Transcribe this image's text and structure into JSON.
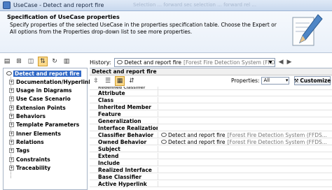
{
  "window": {
    "title": "UseCase - Detect and report fire",
    "ghost_titles": "Selection ... forward sec selection ... forward rel ..."
  },
  "header": {
    "title": "Specification of UseCase properties",
    "description": "Specify properties of the selected UseCase in the properties specification table. Choose the Expert or All options from the Properties drop-down list to see more properties.",
    "icon": "pen-icon"
  },
  "history": {
    "label": "History:",
    "element": "Detect and report fire",
    "element_path": "[Forest Fire Detection System (FFDS)::..."
  },
  "tree": {
    "items": [
      {
        "label": "Detect and report fire",
        "selected": true
      },
      {
        "label": "Documentation/Hyperlinks"
      },
      {
        "label": "Usage in Diagrams"
      },
      {
        "label": "Use Case Scenario"
      },
      {
        "label": "Extension Points"
      },
      {
        "label": "Behaviors"
      },
      {
        "label": "Template Parameters"
      },
      {
        "label": "Inner Elements"
      },
      {
        "label": "Relations"
      },
      {
        "label": "Tags"
      },
      {
        "label": "Constraints"
      },
      {
        "label": "Traceability"
      }
    ]
  },
  "table": {
    "header": "Detect and report fire",
    "properties_label": "Properties:",
    "properties_value": "All",
    "customize_label": "Customize",
    "rows": [
      {
        "key": "Redefined Classifier",
        "value": ""
      },
      {
        "key": "Attribute",
        "value": ""
      },
      {
        "key": "Class",
        "value": ""
      },
      {
        "key": "Inherited Member",
        "value": ""
      },
      {
        "key": "Feature",
        "value": ""
      },
      {
        "key": "Generalization",
        "value": ""
      },
      {
        "key": "Interface Realization",
        "value": ""
      },
      {
        "key": "Classifier Behavior",
        "value": "Detect and report fire",
        "path": "[Forest Fire Detection System (FFDS..."
      },
      {
        "key": "Owned Behavior",
        "value": "Detect and report fire",
        "path": "[Forest Fire Detection System (FFDS..."
      },
      {
        "key": "Subject",
        "value": ""
      },
      {
        "key": "Extend",
        "value": ""
      },
      {
        "key": "Include",
        "value": ""
      },
      {
        "key": "Realized Interface",
        "value": ""
      },
      {
        "key": "Base Classifier",
        "value": ""
      },
      {
        "key": "Active Hyperlink",
        "value": ""
      }
    ]
  },
  "colors": {
    "selection": "#3169c6",
    "toolbar_active": "#fbd98a"
  }
}
